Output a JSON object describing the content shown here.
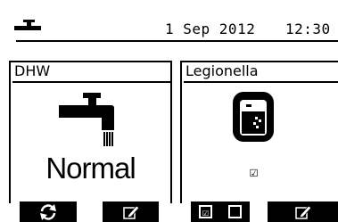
{
  "header": {
    "date": "1 Sep  2012",
    "time": "12:30"
  },
  "panels": {
    "dhw": {
      "title": "DHW",
      "mode": "Normal"
    },
    "legionella": {
      "title": "Legionella",
      "enabled": "☑"
    }
  },
  "function_keys": {
    "f1_icon": "refresh-icon",
    "f2_icon": "edit-icon",
    "f3_check_on": "☑",
    "f3_check_off": "",
    "f4_icon": "edit-icon"
  }
}
